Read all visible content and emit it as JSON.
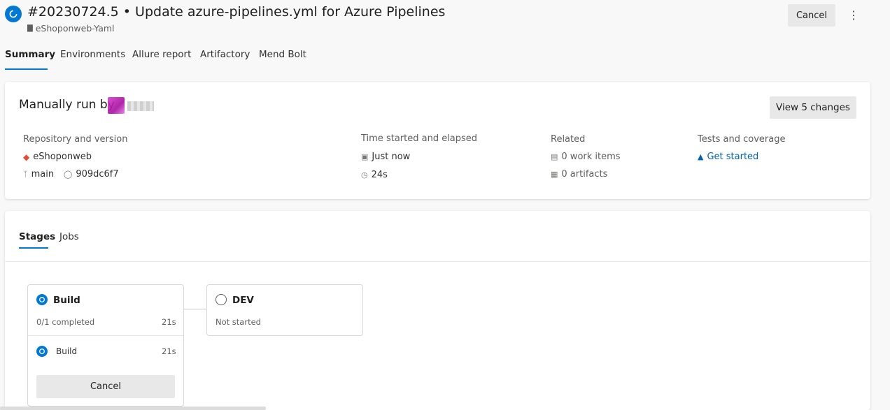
{
  "header": {
    "title": "#20230724.5 • Update azure-pipelines.yml for Azure Pipelines",
    "pipeline_name": "eShoponweb-Yaml",
    "cancel_label": "Cancel",
    "more_label": "⋮"
  },
  "tabs": [
    {
      "label": "Summary",
      "active": true
    },
    {
      "label": "Environments"
    },
    {
      "label": "Allure report"
    },
    {
      "label": "Artifactory"
    },
    {
      "label": "Mend Bolt"
    }
  ],
  "summary": {
    "run_by": "Manually run by",
    "view_changes_label": "View 5 changes",
    "repository": {
      "label": "Repository and version",
      "repo_name": "eShoponweb",
      "branch": "main",
      "commit": "909dc6f7"
    },
    "time": {
      "label": "Time started and elapsed",
      "started": "Just now",
      "elapsed": "24s"
    },
    "related": {
      "label": "Related",
      "work_items": "0 work items",
      "artifacts": "0 artifacts"
    },
    "tests": {
      "label": "Tests and coverage",
      "link": "Get started"
    }
  },
  "stage_tabs": [
    {
      "label": "Stages",
      "active": true
    },
    {
      "label": "Jobs"
    }
  ],
  "stages": {
    "build": {
      "name": "Build",
      "progress": "0/1 completed",
      "duration": "21s",
      "job_name": "Build",
      "job_duration": "21s",
      "cancel_label": "Cancel"
    },
    "dev": {
      "name": "DEV",
      "status": "Not started"
    }
  },
  "colors": {
    "accent": "#0078d4",
    "link": "#0063b1",
    "repo_icon": "#e04e39"
  }
}
